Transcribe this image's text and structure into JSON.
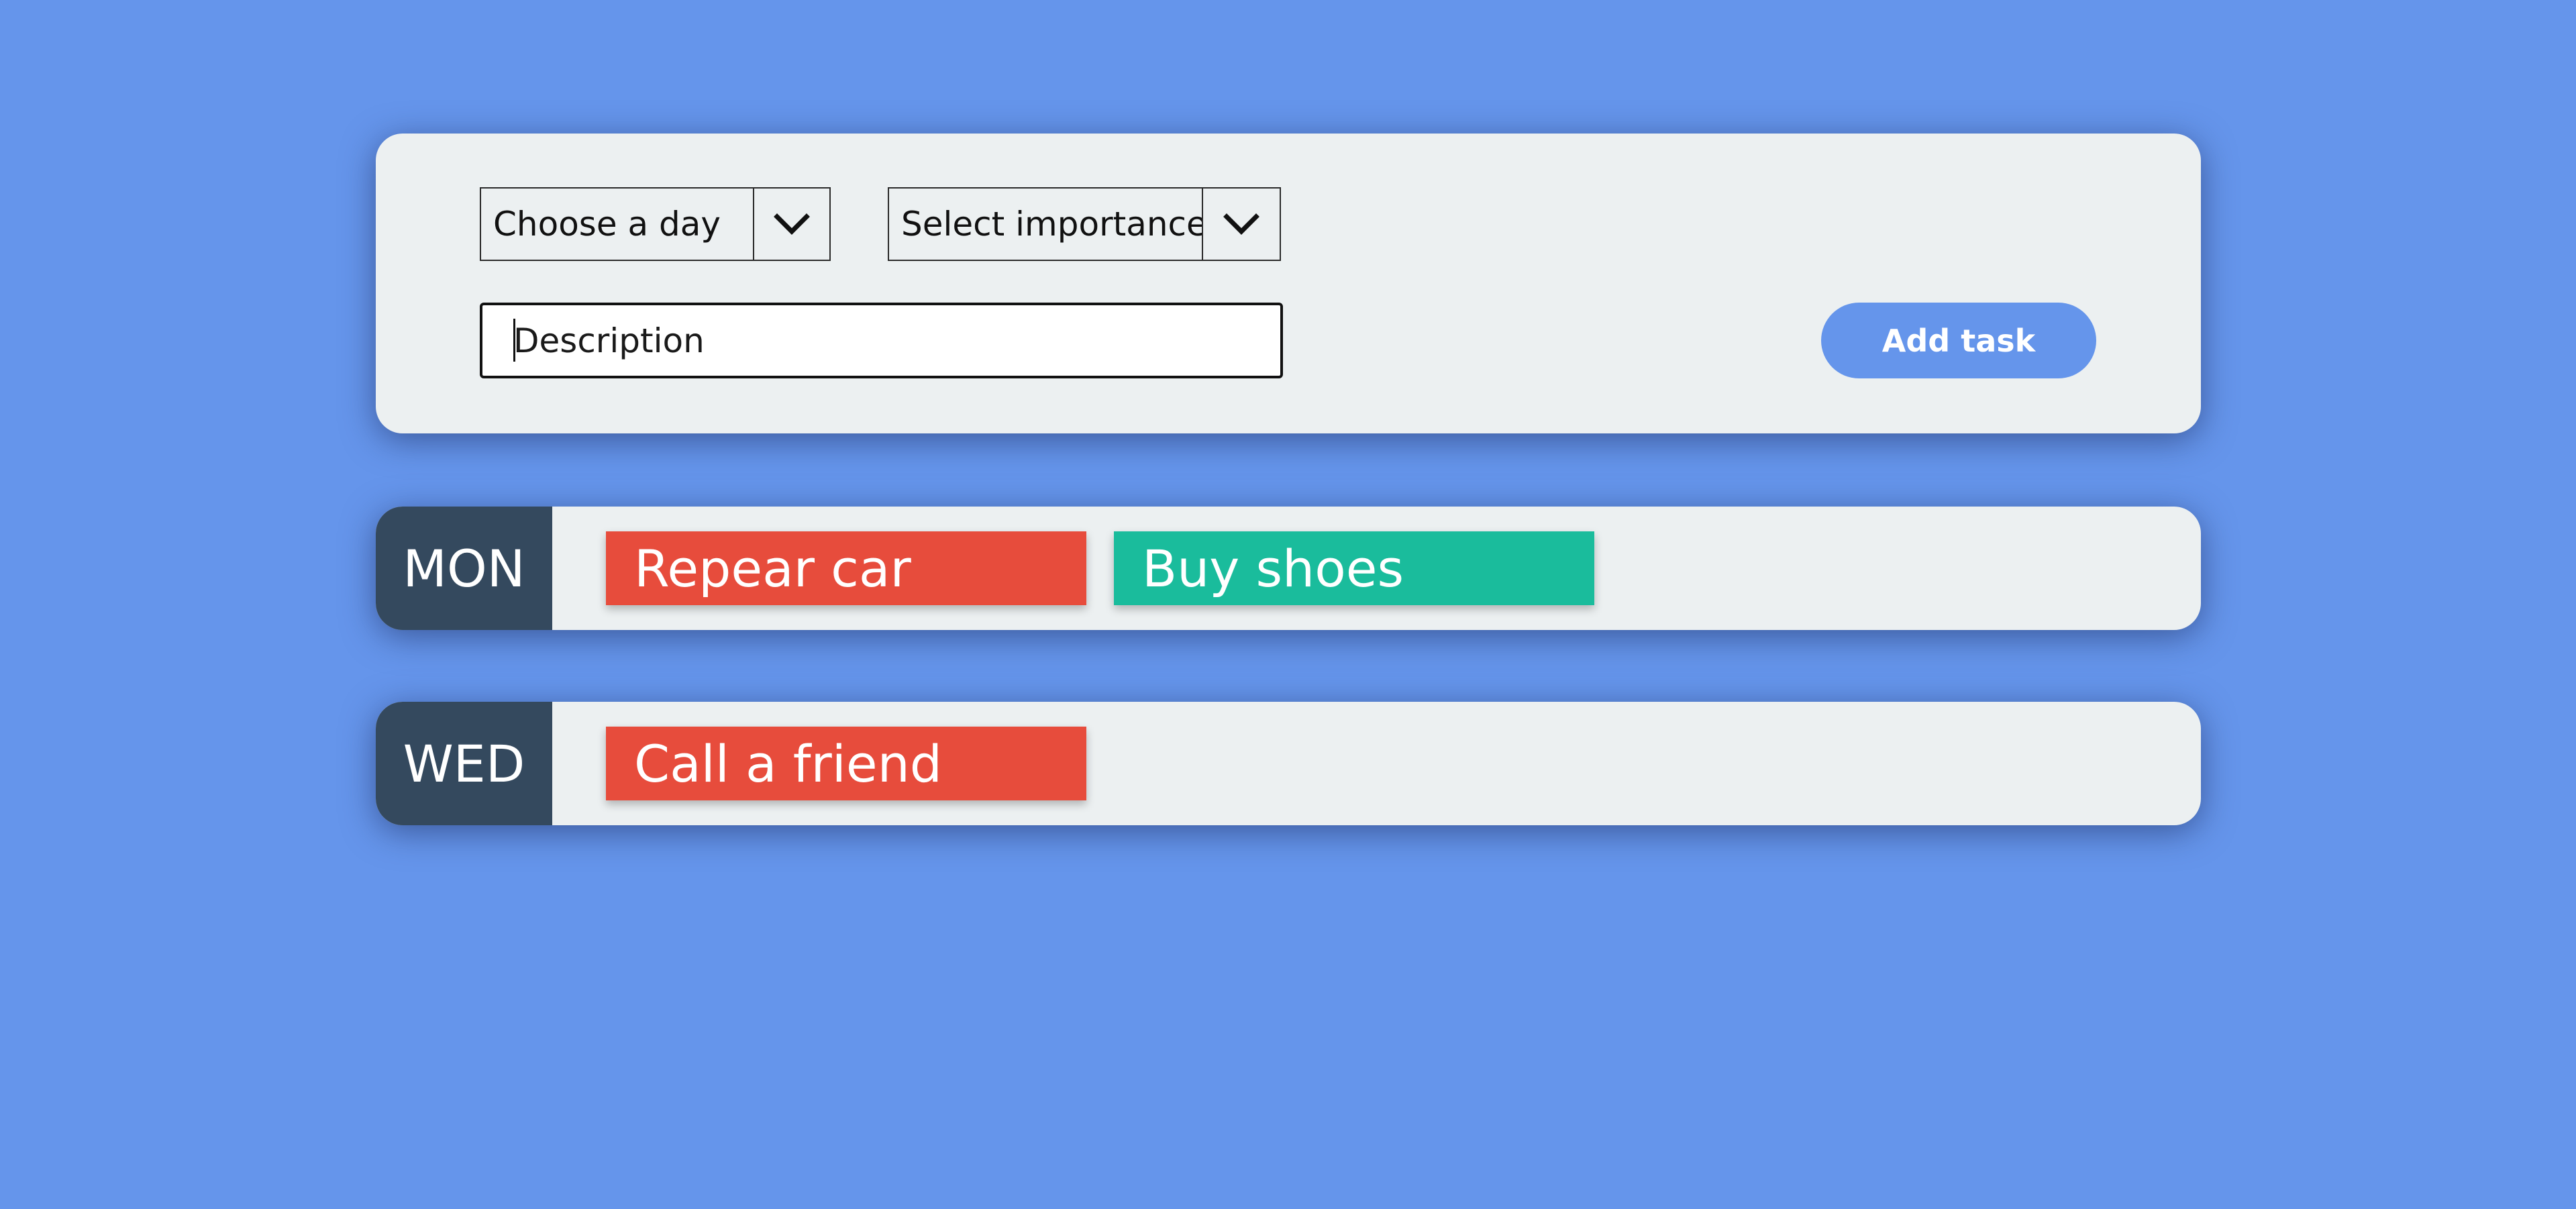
{
  "form": {
    "day_select": {
      "value": "Choose a day",
      "icon": "chevron-down-icon"
    },
    "importance_select": {
      "value": "Select importance",
      "icon": "chevron-down-icon"
    },
    "description": {
      "placeholder": "Description",
      "value": ""
    },
    "add_button_label": "Add task"
  },
  "days": [
    {
      "label": "MON",
      "tasks": [
        {
          "text": "Repear car",
          "color": "#e74c3c"
        },
        {
          "text": "Buy shoes",
          "color": "#1abc9c"
        }
      ]
    },
    {
      "label": "WED",
      "tasks": [
        {
          "text": "Call a friend",
          "color": "#e74c3c"
        }
      ]
    }
  ],
  "colors": {
    "background": "#6595eb",
    "card": "#ecf0f1",
    "day_label_bg": "#34495e",
    "accent": "#6595eb",
    "importance_high": "#e74c3c",
    "importance_low": "#1abc9c"
  }
}
